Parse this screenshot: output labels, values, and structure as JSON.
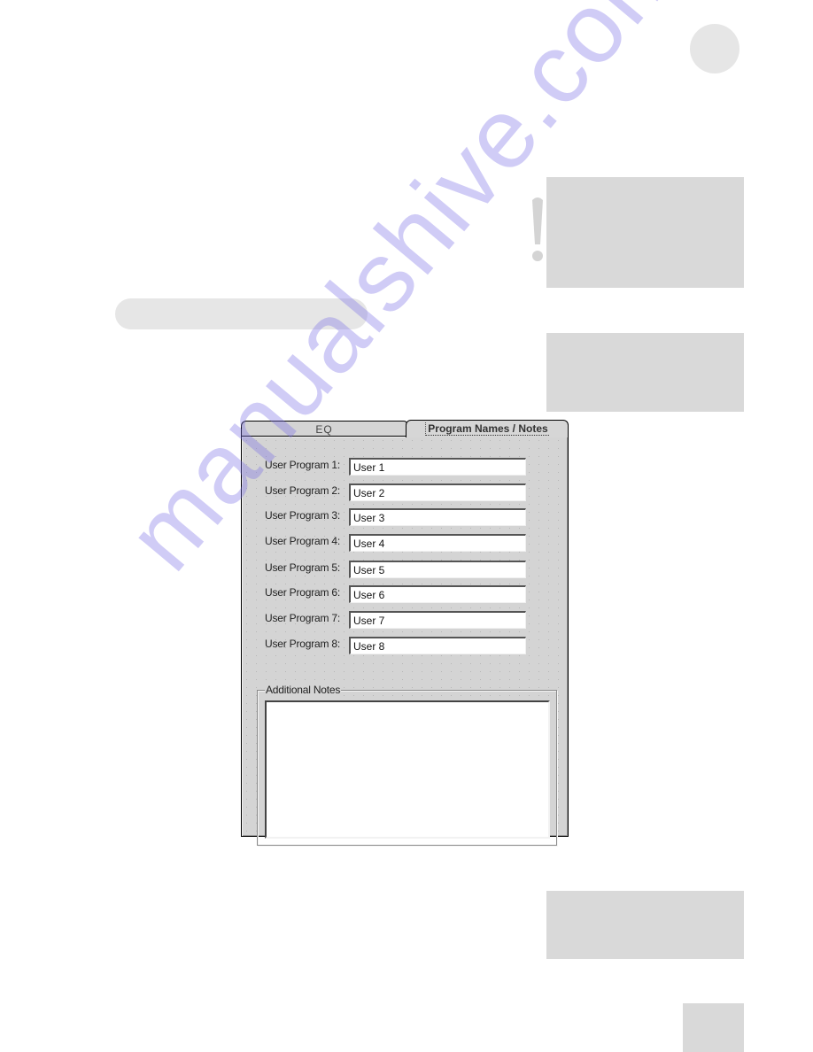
{
  "dialog": {
    "tabs": [
      {
        "label": "EQ",
        "active": false
      },
      {
        "label": "Program Names / Notes",
        "active": true
      }
    ],
    "programs": [
      {
        "label": "User Program 1:",
        "value": "User 1"
      },
      {
        "label": "User Program 2:",
        "value": "User 2"
      },
      {
        "label": "User Program 3:",
        "value": "User 3"
      },
      {
        "label": "User Program 4:",
        "value": "User 4"
      },
      {
        "label": "User Program 5:",
        "value": "User 5"
      },
      {
        "label": "User Program 6:",
        "value": "User 6"
      },
      {
        "label": "User Program 7:",
        "value": "User 7"
      },
      {
        "label": "User Program 8:",
        "value": "User 8"
      }
    ],
    "notes": {
      "legend": "Additional Notes",
      "value": ""
    }
  },
  "page": {
    "warning_symbol": "!",
    "watermark": "manualshive.com"
  },
  "colors": {
    "panel_bg": "#d4d4d4",
    "page_box": "#d9d9d9",
    "page_pill": "#e6e6e6",
    "watermark": "#786ee6"
  }
}
